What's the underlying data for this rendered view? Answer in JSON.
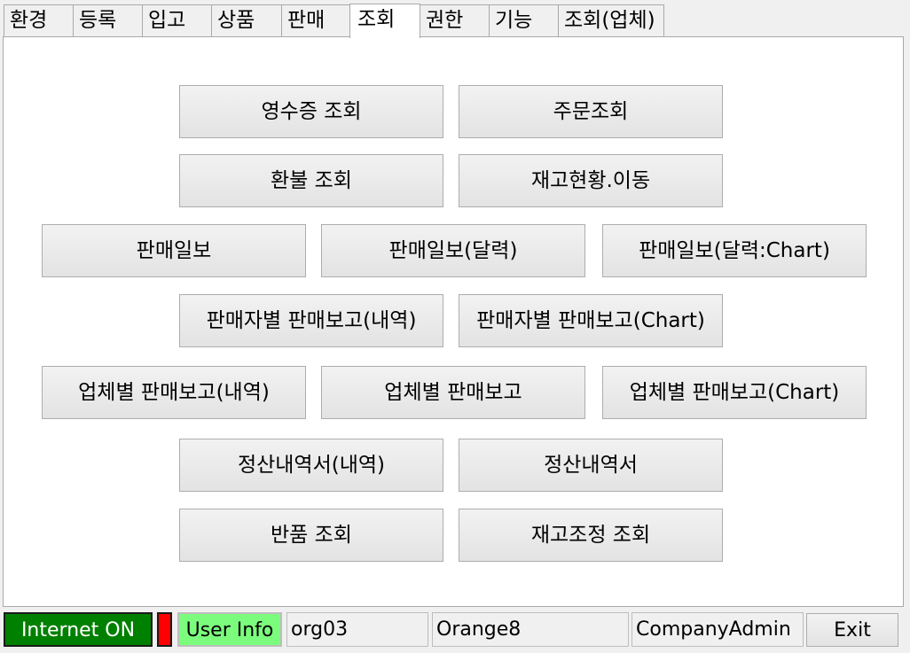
{
  "tabs": [
    {
      "label": "환경"
    },
    {
      "label": "등록"
    },
    {
      "label": "입고"
    },
    {
      "label": "상품"
    },
    {
      "label": "판매"
    },
    {
      "label": "조회",
      "active": true
    },
    {
      "label": "권한"
    },
    {
      "label": "기능"
    },
    {
      "label": "조회(업체)"
    }
  ],
  "buttons": {
    "receipt": "영수증 조회",
    "order": "주문조회",
    "refund": "환불 조회",
    "stock_move": "재고현황.이동",
    "daily": "판매일보",
    "daily_calendar": "판매일보(달력)",
    "daily_calendar_chart": "판매일보(달력:Chart)",
    "seller_detail": "판매자별 판매보고(내역)",
    "seller_chart": "판매자별 판매보고(Chart)",
    "vendor_detail": "업체별 판매보고(내역)",
    "vendor_report": "업체별 판매보고",
    "vendor_chart": "업체별 판매보고(Chart)",
    "settlement_detail": "정산내역서(내역)",
    "settlement": "정산내역서",
    "return": "반품 조회",
    "stock_adjust": "재고조정 조회"
  },
  "status": {
    "internet": "Internet ON",
    "user_info": "User Info",
    "org": "org03",
    "company": "Orange8",
    "role": "CompanyAdmin",
    "exit": "Exit"
  },
  "colors": {
    "internet_on": "#008000",
    "led": "#ff0000",
    "user_info": "#7cfc7c"
  }
}
